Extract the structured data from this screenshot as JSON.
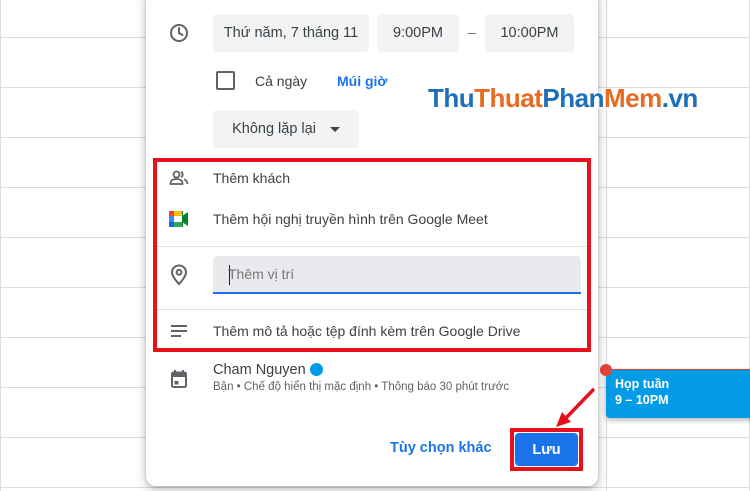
{
  "event_dialog": {
    "date": "Thứ năm, 7 tháng 11",
    "start_time": "9:00PM",
    "time_separator": "–",
    "end_time": "10:00PM",
    "all_day_label": "Cả ngày",
    "timezone_label": "Múi giờ",
    "repeat_value": "Không lặp lại",
    "add_guests": "Thêm khách",
    "add_meet": "Thêm hội nghị truyền hình trên Google Meet",
    "location_placeholder": "Thêm vị trí",
    "description": "Thêm mô tả hoặc tệp đính kèm trên Google Drive",
    "calendar_owner": "Cham Nguyen",
    "calendar_details": "Bận • Chế độ hiển thị mặc định • Thông báo 30 phút trước",
    "more_options": "Tùy chọn khác",
    "save": "Lưu"
  },
  "calendar_event": {
    "title": "Họp tuần",
    "time": "9 – 10PM"
  },
  "watermark": {
    "part1": "Thu",
    "part2": "Thuat",
    "part3": "Phan",
    "part4": "Mem",
    "part5": ".vn"
  },
  "colors": {
    "accent": "#1a73e8",
    "event": "#039be5",
    "highlight": "#e8101a",
    "now_line": "#ea4335"
  }
}
